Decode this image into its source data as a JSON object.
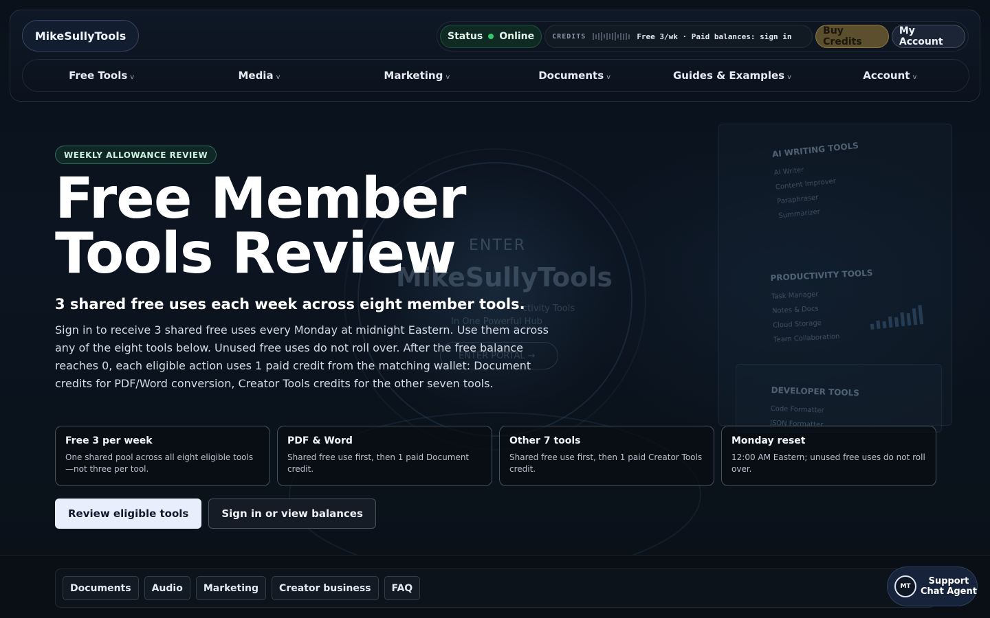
{
  "brand": {
    "name": "MikeSullyTools"
  },
  "topbar": {
    "status_label": "Status",
    "status_value": "Online",
    "credits_label": "CREDITS",
    "credits_text": "Free 3/wk · Paid balances: sign in",
    "buy_label": "Buy Credits",
    "account_label": "My Account",
    "colors": {
      "status": "#34c76e",
      "buy": "#5b4f2e"
    }
  },
  "nav": {
    "items": [
      {
        "label": "Free Tools",
        "chevron": "v"
      },
      {
        "label": "Media",
        "chevron": "v"
      },
      {
        "label": "Marketing",
        "chevron": "v"
      },
      {
        "label": "Documents",
        "chevron": "v"
      },
      {
        "label": "Guides & Examples",
        "chevron": "v"
      },
      {
        "label": "Account",
        "chevron": "v"
      }
    ]
  },
  "hero": {
    "eyebrow": "WEEKLY ALLOWANCE REVIEW",
    "title_line1": "Free Member",
    "title_line2": "Tools Review",
    "subtitle": "3 shared free uses each week across eight member tools.",
    "body": "Sign in to receive 3 shared free uses every Monday at midnight Eastern. Use them across any of the eight tools below. Unused free uses do not roll over. After the free balance reaches 0, each eligible action uses 1 paid credit from the matching wallet: Document credits for PDF/Word conversion, Creator Tools credits for the other seven tools.",
    "cards": [
      {
        "title": "Free 3 per week",
        "desc": "One shared pool across all eight eligible tools—not three per tool."
      },
      {
        "title": "PDF & Word",
        "desc": "Shared free use first, then 1 paid Document credit."
      },
      {
        "title": "Other 7 tools",
        "desc": "Shared free use first, then 1 paid Creator Tools credit."
      },
      {
        "title": "Monday reset",
        "desc": "12:00 AM Eastern; unused free uses do not roll over."
      }
    ],
    "cta_primary": "Review eligible tools",
    "cta_secondary": "Sign in or view balances"
  },
  "background_art": {
    "enter": "ENTER",
    "portal_title": "MikeSullyTools",
    "sub1": "ctivity Tools",
    "sub2": "In One Powerful Hub",
    "button": "ENTER PORTAL →",
    "panels": [
      {
        "heading": "AI WRITING TOOLS",
        "items": [
          "AI Writer",
          "Content Improver",
          "Paraphraser",
          "Summarizer"
        ]
      },
      {
        "heading": "PRODUCTIVITY TOOLS",
        "items": [
          "Task Manager",
          "Notes & Docs",
          "Cloud Storage",
          "Team Collaboration"
        ]
      },
      {
        "heading": "DEVELOPER TOOLS",
        "items": [
          "Code Formatter",
          "JSON Formatter"
        ]
      }
    ]
  },
  "subnav": {
    "items": [
      "Documents",
      "Audio",
      "Marketing",
      "Creator business",
      "FAQ"
    ]
  },
  "support": {
    "avatar": "MT",
    "line1": "Support",
    "line2": "Chat Agent"
  }
}
